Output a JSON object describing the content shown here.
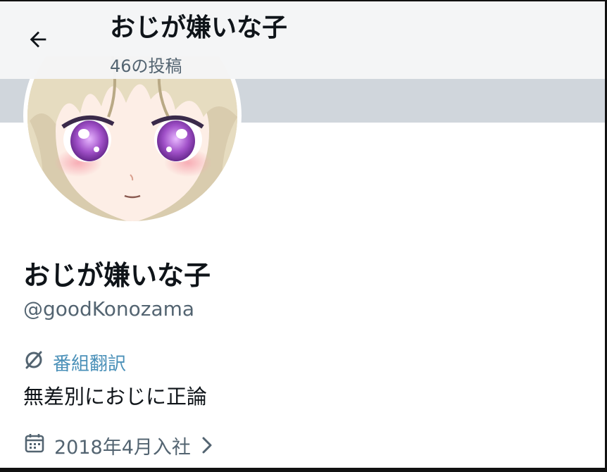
{
  "header": {
    "title": "おじが嫌いな子",
    "post_count": "46の投稿"
  },
  "profile": {
    "display_name": "おじが嫌いな子",
    "handle": "@goodKonozama",
    "affiliation": "番組翻訳",
    "bio": "無差別におじに正論",
    "joined": "2018年4月入社"
  },
  "icons": {
    "back": "arrow-left-icon",
    "affiliation": "no-entry-circle-icon",
    "calendar": "calendar-icon",
    "chevron": "chevron-right-icon"
  },
  "colors": {
    "primary_text": "#0f1419",
    "secondary_text": "#536471",
    "link": "#4a90b8",
    "banner": "#d0d6dc",
    "avatar_eyes": "#8a3fb0"
  }
}
